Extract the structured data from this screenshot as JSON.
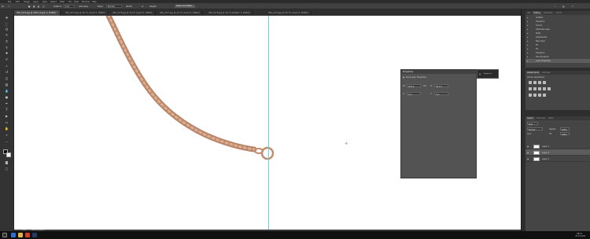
{
  "app": {
    "name": "Adobe Photoshop"
  },
  "menubar": {
    "items": [
      "File",
      "Edit",
      "Image",
      "Layer",
      "Type",
      "Select",
      "Filter",
      "3D",
      "View",
      "Window",
      "Help"
    ]
  },
  "options": {
    "feather_label": "Feather:",
    "feather_value": "0 px",
    "antialias_label": "Anti-alias",
    "style_label": "Style:",
    "style_value": "Normal",
    "width_label": "Width:",
    "height_label": "Height:",
    "select_mask_label": "Select and Mask..."
  },
  "tabs": [
    {
      "label": "IMG_1074.jpg @ 100% (Layer 2, RGB/8) *",
      "active": true
    },
    {
      "label": "IMG_1075.jpg @ 16.7% (Layer 0, RGB/8)",
      "active": false
    },
    {
      "label": "IMG_1076.jpg @ 12.5% (Layer 0, RGB/8)",
      "active": false
    },
    {
      "label": "IMG_1077.jpg @ 16.7% (Layer 0, RGB/8)",
      "active": false
    },
    {
      "label": "IMG_1078.jpg @ 16.7% (Pattern 1, RGB/8)",
      "active": false
    },
    {
      "label": "IMG_1079.jpg @ 16.7% (Layer 0, RGB/8)",
      "active": false
    }
  ],
  "history_panel": {
    "tabs": [
      "Info",
      "Swatches",
      "History",
      "Colors",
      "Layers",
      "Channels"
    ],
    "rows": [
      {
        "label": "Untitled",
        "value": ""
      },
      {
        "label": "Transform",
        "value": ""
      },
      {
        "label": "Cutout",
        "value": ""
      },
      {
        "label": "Duplicate Layer",
        "value": ""
      },
      {
        "label": "Paste",
        "value": ""
      },
      {
        "label": "Adjustments",
        "value": ""
      },
      {
        "label": "New Layer",
        "value": ""
      },
      {
        "label": "Fill",
        "value": ""
      },
      {
        "label": "Fill",
        "value": ""
      },
      {
        "label": "Transform",
        "value": ""
      },
      {
        "label": "Free Transform",
        "value": ""
      },
      {
        "label": "Layer Properties",
        "value": ""
      }
    ]
  },
  "adjustments_panel": {
    "tabs": [
      "Adjustments",
      "Libraries"
    ],
    "hint": "Add an adjustment"
  },
  "layers_panel": {
    "tabs": [
      "Layers",
      "Channels",
      "Paths"
    ],
    "kind_label": "Kind",
    "blend_mode": "Normal",
    "opacity_label": "Opacity:",
    "opacity_value": "100%",
    "lock_label": "Lock:",
    "fill_label": "Fill:",
    "fill_value": "100%",
    "layers": [
      {
        "name": "Layer 3",
        "selected": false
      },
      {
        "name": "Layer 2",
        "selected": true
      },
      {
        "name": "Layer 1",
        "selected": false
      }
    ]
  },
  "properties_panel": {
    "title": "Properties",
    "section": "Pixel Layer Properties",
    "w_label": "W:",
    "w_value": "22.6 in",
    "h_label": "H:",
    "h_value": "30.4 in",
    "x_label": "X:",
    "x_value": "0 in",
    "y_label": "Y:",
    "y_value": "0 in",
    "link_label": "GO"
  },
  "mini_popup": {
    "label": "Properties"
  },
  "statusbar": {
    "zoom": "100%",
    "doc": "Doc: 40.1M/44.2M"
  },
  "taskbar": {
    "time": "18:11",
    "date": "29-04-2018"
  },
  "colors": {
    "accent": "#6fd0e2",
    "chain": "#c89272",
    "panel": "#535353"
  }
}
